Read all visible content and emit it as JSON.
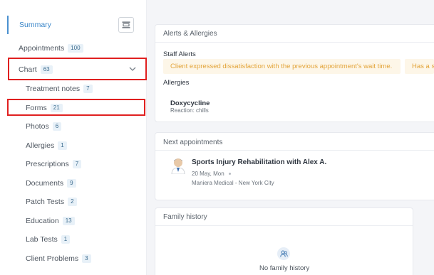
{
  "sidebar": {
    "items": [
      {
        "label": "Summary"
      },
      {
        "label": "Appointments",
        "count": "100"
      },
      {
        "label": "Chart",
        "count": "63"
      },
      {
        "label": "Treatment notes",
        "count": "7"
      },
      {
        "label": "Forms",
        "count": "21"
      },
      {
        "label": "Photos",
        "count": "6"
      },
      {
        "label": "Allergies",
        "count": "1"
      },
      {
        "label": "Prescriptions",
        "count": "7"
      },
      {
        "label": "Documents",
        "count": "9"
      },
      {
        "label": "Patch Tests",
        "count": "2"
      },
      {
        "label": "Education",
        "count": "13"
      },
      {
        "label": "Lab Tests",
        "count": "1"
      },
      {
        "label": "Client Problems",
        "count": "3"
      }
    ]
  },
  "alerts_card": {
    "title": "Alerts & Allergies",
    "staff_alerts_heading": "Staff Alerts",
    "staff_alerts": [
      "Client expressed dissatisfaction with the previous appointment's wait time.",
      "Has a s"
    ],
    "allergies_heading": "Allergies",
    "allergy": {
      "name": "Doxycycline",
      "reaction": "Reaction: chills"
    }
  },
  "appointments_card": {
    "title": "Next appointments",
    "appointment": {
      "title": "Sports Injury Rehabilitation with Alex A.",
      "date": "20 May, Mon",
      "location": "Maniera Medical - New York City"
    }
  },
  "family_card": {
    "title": "Family history",
    "empty_text": "No family history"
  },
  "colors": {
    "accent": "#3a86c9",
    "highlight": "#e02020",
    "alert_bg": "#fdf6e8",
    "alert_text": "#e3a43a"
  },
  "icons": [
    "collapse-sidebar-icon",
    "chevron-down-icon",
    "doctor-avatar-icon",
    "family-icon"
  ]
}
